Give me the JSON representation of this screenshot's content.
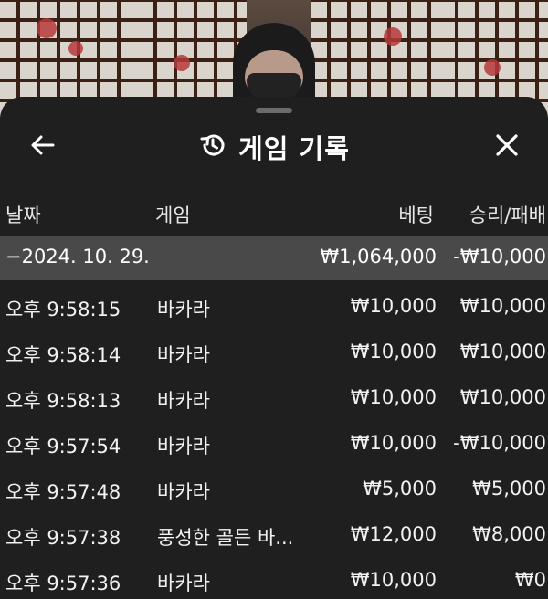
{
  "header": {
    "title": "게임 기록",
    "back_icon": "arrow-left-icon",
    "history_icon": "history-icon",
    "close_icon": "close-icon"
  },
  "columns": {
    "date": "날짜",
    "game": "게임",
    "bet": "베팅",
    "win_loss": "승리/패배"
  },
  "date_group": {
    "date": "−2024. 10. 29.",
    "bet_total": "₩1,064,000",
    "win_loss_total": "-₩10,000"
  },
  "records": [
    {
      "time": "오후 9:58:15",
      "game": "바카라",
      "bet": "₩10,000",
      "win_loss": "₩10,000"
    },
    {
      "time": "오후 9:58:14",
      "game": "바카라",
      "bet": "₩10,000",
      "win_loss": "₩10,000"
    },
    {
      "time": "오후 9:58:13",
      "game": "바카라",
      "bet": "₩10,000",
      "win_loss": "₩10,000"
    },
    {
      "time": "오후 9:57:54",
      "game": "바카라",
      "bet": "₩10,000",
      "win_loss": "-₩10,000"
    },
    {
      "time": "오후 9:57:48",
      "game": "바카라",
      "bet": "₩5,000",
      "win_loss": "₩5,000"
    },
    {
      "time": "오후 9:57:38",
      "game": "풍성한 골든 바...",
      "bet": "₩12,000",
      "win_loss": "₩8,000"
    },
    {
      "time": "오후 9:57:36",
      "game": "바카라",
      "bet": "₩10,000",
      "win_loss": "₩0"
    }
  ]
}
